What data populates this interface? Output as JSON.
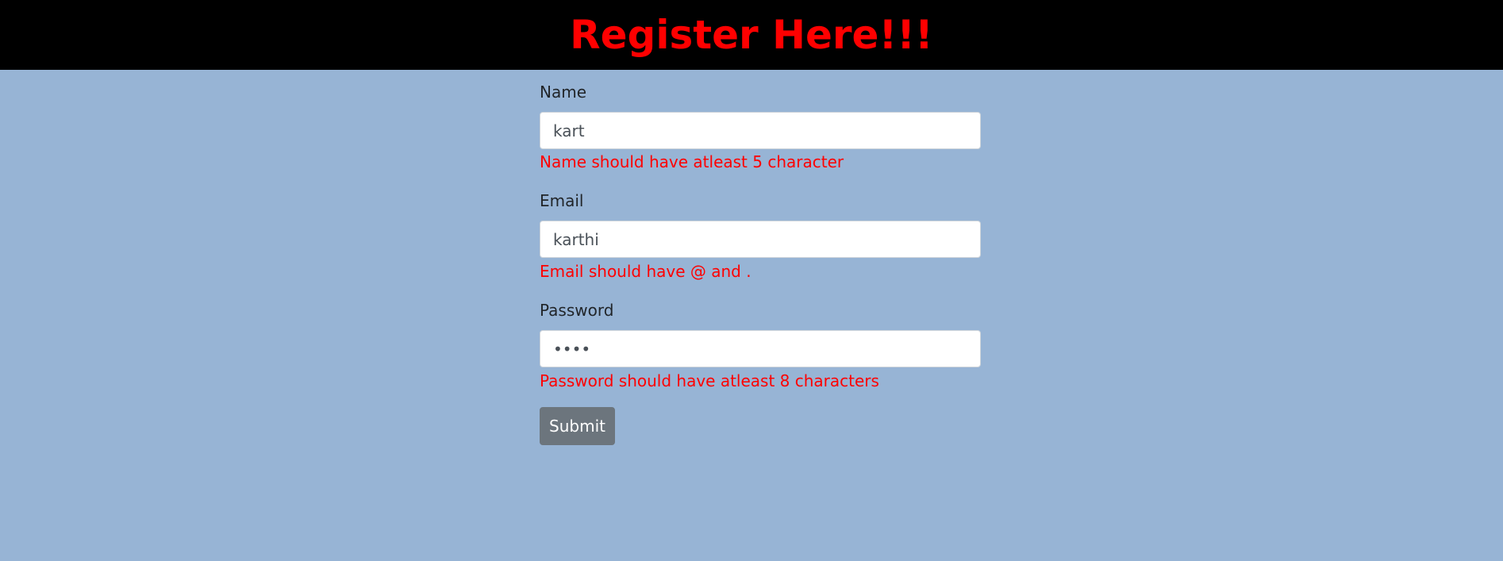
{
  "header": {
    "title": "Register Here!!!"
  },
  "form": {
    "name": {
      "label": "Name",
      "value": "kart",
      "error": "Name should have atleast 5 character"
    },
    "email": {
      "label": "Email",
      "value": "karthi",
      "error": "Email should have @ and ."
    },
    "password": {
      "label": "Password",
      "value": "••••",
      "error": "Password should have atleast 8 characters"
    },
    "submit_label": "Submit"
  },
  "colors": {
    "background": "#97b4d5",
    "header_bg": "#000000",
    "title": "#ff0000",
    "error": "#ff0000",
    "button": "#6c757d"
  }
}
